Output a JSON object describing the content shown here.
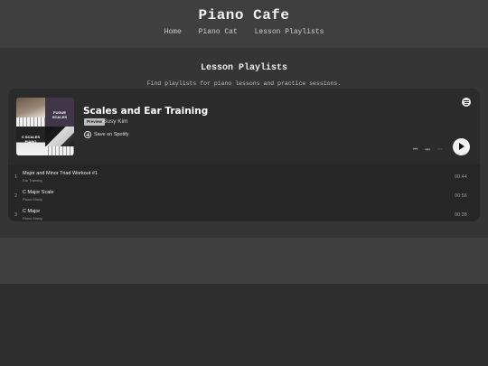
{
  "site": {
    "title": "Piano Cafe",
    "nav": [
      "Home",
      "Piano Cat",
      "Lesson Playlists"
    ]
  },
  "page": {
    "heading": "Lesson Playlists",
    "subheading": "Find playlists for piano lessons and practice sessions."
  },
  "embed": {
    "playlist_title": "Scales and Ear Training",
    "badge": "Preview",
    "owner": "Susy Kim",
    "save_label": "Save on Spotify",
    "cover_labels": {
      "top_right": "FUGUE\nSCALES",
      "bottom_left": "C SCALES\nPIANO"
    },
    "tracks": [
      {
        "number": "1",
        "name": "Major and Minor Triad Workout #1",
        "artist": "Ear Training",
        "duration": "00:44"
      },
      {
        "number": "2",
        "name": "C Major Scale",
        "artist": "Piano Manly",
        "duration": "00:56"
      },
      {
        "number": "3",
        "name": "C Major",
        "artist": "Piano Manly",
        "duration": "00:38"
      }
    ],
    "icons": [
      "spotify-logo-icon",
      "previous-track-icon",
      "next-track-icon",
      "more-options-icon",
      "play-icon",
      "add-circle-icon"
    ]
  },
  "colors": {
    "header_bg": "#3f3f3f",
    "page_bg": "#2e2e2e",
    "embed_bg": "#262626",
    "play_button": "#f4f4f4"
  }
}
